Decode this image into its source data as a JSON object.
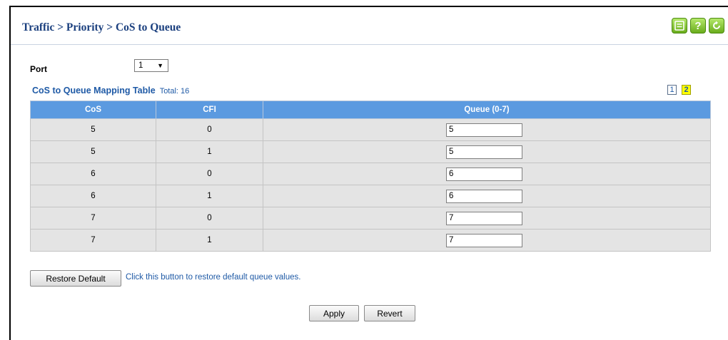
{
  "breadcrumb": "Traffic > Priority > CoS to Queue",
  "header_buttons": {
    "save_icon": "save-icon",
    "help_label": "?",
    "refresh_icon": "refresh-icon"
  },
  "port": {
    "label": "Port",
    "value": "1",
    "arrow": "▼"
  },
  "table": {
    "title": "CoS to Queue Mapping Table",
    "total": "Total: 16",
    "columns": [
      "CoS",
      "CFI",
      "Queue (0-7)"
    ],
    "rows": [
      {
        "cos": "5",
        "cfi": "0",
        "queue": "5"
      },
      {
        "cos": "5",
        "cfi": "1",
        "queue": "5"
      },
      {
        "cos": "6",
        "cfi": "0",
        "queue": "6"
      },
      {
        "cos": "6",
        "cfi": "1",
        "queue": "6"
      },
      {
        "cos": "7",
        "cfi": "0",
        "queue": "7"
      },
      {
        "cos": "7",
        "cfi": "1",
        "queue": "7"
      }
    ]
  },
  "pagination": {
    "pages": [
      "1",
      "2"
    ],
    "current": "2"
  },
  "restore": {
    "button": "Restore Default",
    "description": "Click this button to restore default queue values."
  },
  "actions": {
    "apply": "Apply",
    "revert": "Revert"
  },
  "colors": {
    "title_blue": "#1a3f7e",
    "link_blue": "#1f5aa6",
    "table_header": "#5b9ae0",
    "row_bg": "#e4e4e4",
    "icon_green": "#6aac1c",
    "current_page_highlight": "#ffff00"
  }
}
